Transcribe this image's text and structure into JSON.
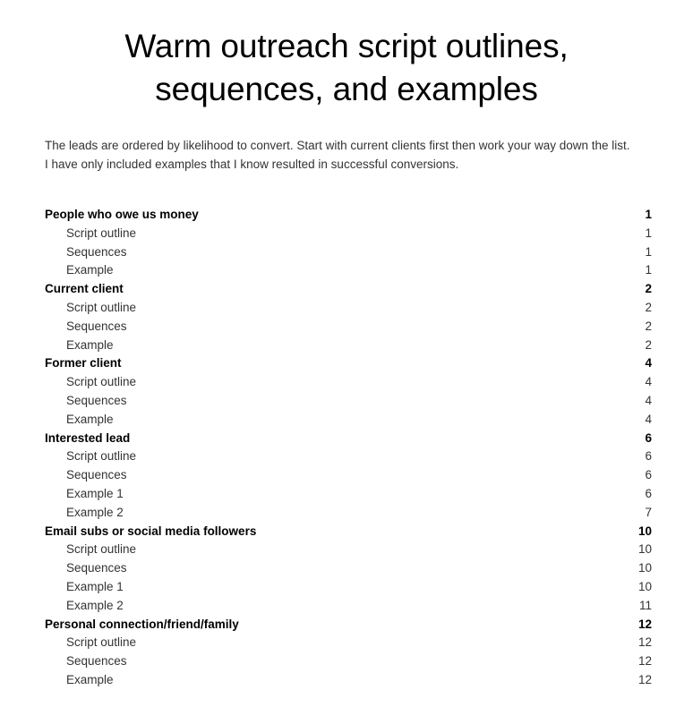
{
  "document": {
    "title": "Warm outreach script outlines, sequences, and examples",
    "intro": "The leads are ordered by likelihood to convert. Start with current clients first then work your way down the list. I have only included examples that I know resulted in successful conversions."
  },
  "toc": {
    "entries": [
      {
        "label": "People who owe us money",
        "page": "1",
        "level": 1
      },
      {
        "label": "Script outline",
        "page": "1",
        "level": 2
      },
      {
        "label": "Sequences",
        "page": "1",
        "level": 2
      },
      {
        "label": "Example",
        "page": "1",
        "level": 2
      },
      {
        "label": "Current client",
        "page": "2",
        "level": 1
      },
      {
        "label": "Script outline",
        "page": "2",
        "level": 2
      },
      {
        "label": "Sequences",
        "page": "2",
        "level": 2
      },
      {
        "label": "Example",
        "page": "2",
        "level": 2
      },
      {
        "label": "Former client",
        "page": "4",
        "level": 1
      },
      {
        "label": "Script outline",
        "page": "4",
        "level": 2
      },
      {
        "label": "Sequences",
        "page": "4",
        "level": 2
      },
      {
        "label": "Example",
        "page": "4",
        "level": 2
      },
      {
        "label": "Interested lead",
        "page": "6",
        "level": 1
      },
      {
        "label": "Script outline",
        "page": "6",
        "level": 2
      },
      {
        "label": "Sequences",
        "page": "6",
        "level": 2
      },
      {
        "label": "Example 1",
        "page": "6",
        "level": 2
      },
      {
        "label": "Example 2",
        "page": "7",
        "level": 2
      },
      {
        "label": "Email subs or social media followers",
        "page": "10",
        "level": 1
      },
      {
        "label": "Script outline",
        "page": "10",
        "level": 2
      },
      {
        "label": "Sequences",
        "page": "10",
        "level": 2
      },
      {
        "label": "Example 1",
        "page": "10",
        "level": 2
      },
      {
        "label": "Example 2",
        "page": "11",
        "level": 2
      },
      {
        "label": "Personal connection/friend/family",
        "page": "12",
        "level": 1
      },
      {
        "label": "Script outline",
        "page": "12",
        "level": 2
      },
      {
        "label": "Sequences",
        "page": "12",
        "level": 2
      },
      {
        "label": "Example",
        "page": "12",
        "level": 2
      }
    ]
  },
  "colors": {
    "background": "#ffffff",
    "heading_text": "#000000",
    "body_text": "#333333"
  }
}
